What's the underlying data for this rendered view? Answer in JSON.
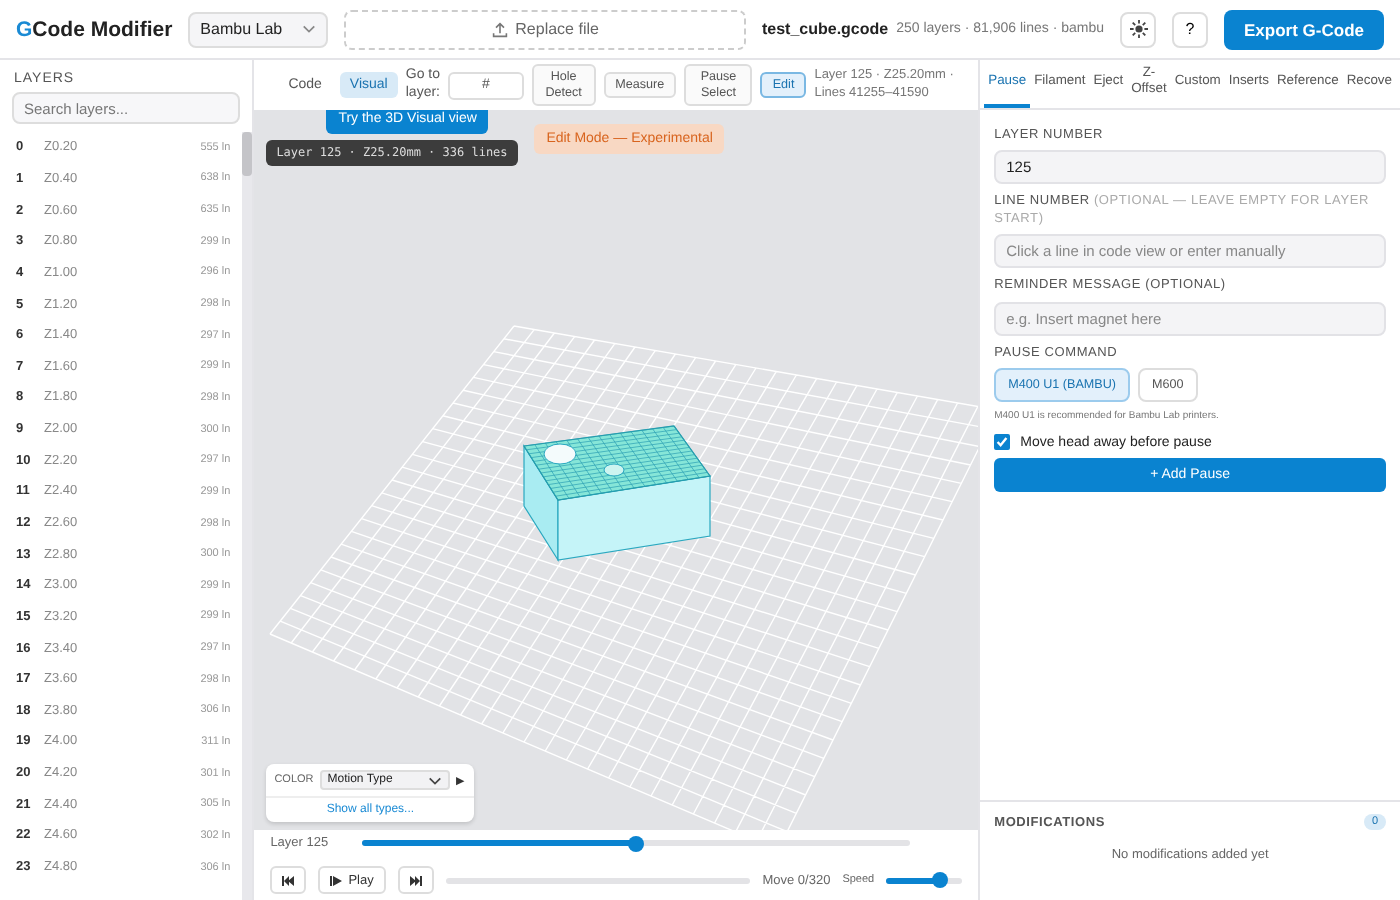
{
  "header": {
    "logo": "GCode Modifier",
    "printer_select": {
      "value": "Bambu Lab"
    },
    "replace_file": "Replace file",
    "file_name": "test_cube.gcode",
    "file_meta": "250 layers · 81,906 lines · bambu",
    "help": "?",
    "export": "Export G-Code"
  },
  "layers": {
    "title": "LAYERS",
    "search_placeholder": "Search layers...",
    "rows": [
      {
        "index": "0",
        "z": "Z0.20",
        "lines": "555 ln"
      },
      {
        "index": "1",
        "z": "Z0.40",
        "lines": "638 ln"
      },
      {
        "index": "2",
        "z": "Z0.60",
        "lines": "635 ln"
      },
      {
        "index": "3",
        "z": "Z0.80",
        "lines": "299 ln"
      },
      {
        "index": "4",
        "z": "Z1.00",
        "lines": "296 ln"
      },
      {
        "index": "5",
        "z": "Z1.20",
        "lines": "298 ln"
      },
      {
        "index": "6",
        "z": "Z1.40",
        "lines": "297 ln"
      },
      {
        "index": "7",
        "z": "Z1.60",
        "lines": "299 ln"
      },
      {
        "index": "8",
        "z": "Z1.80",
        "lines": "298 ln"
      },
      {
        "index": "9",
        "z": "Z2.00",
        "lines": "300 ln"
      },
      {
        "index": "10",
        "z": "Z2.20",
        "lines": "297 ln"
      },
      {
        "index": "11",
        "z": "Z2.40",
        "lines": "299 ln"
      },
      {
        "index": "12",
        "z": "Z2.60",
        "lines": "298 ln"
      },
      {
        "index": "13",
        "z": "Z2.80",
        "lines": "300 ln"
      },
      {
        "index": "14",
        "z": "Z3.00",
        "lines": "299 ln"
      },
      {
        "index": "15",
        "z": "Z3.20",
        "lines": "299 ln"
      },
      {
        "index": "16",
        "z": "Z3.40",
        "lines": "297 ln"
      },
      {
        "index": "17",
        "z": "Z3.60",
        "lines": "298 ln"
      },
      {
        "index": "18",
        "z": "Z3.80",
        "lines": "306 ln"
      },
      {
        "index": "19",
        "z": "Z4.00",
        "lines": "311 ln"
      },
      {
        "index": "20",
        "z": "Z4.20",
        "lines": "301 ln"
      },
      {
        "index": "21",
        "z": "Z4.40",
        "lines": "305 ln"
      },
      {
        "index": "22",
        "z": "Z4.60",
        "lines": "302 ln"
      },
      {
        "index": "23",
        "z": "Z4.80",
        "lines": "306 ln"
      }
    ]
  },
  "toolbar": {
    "views": [
      {
        "label": "Code",
        "selected": false
      },
      {
        "label": "Visual",
        "selected": true
      }
    ],
    "goto_label": "Go to layer:",
    "goto_placeholder": "#",
    "tools": [
      {
        "label": "Hole Detect",
        "on": false
      },
      {
        "label": "Measure",
        "on": false
      },
      {
        "label": "Pause Select",
        "on": false
      },
      {
        "label": "Edit",
        "on": true
      }
    ],
    "info": "Layer 125 · Z25.20mm · Lines 41255–41590"
  },
  "viewport": {
    "tooltip": "Try the 3D Visual view",
    "layer_label": "Layer 125 · Z25.20mm · 336 lines",
    "edit_badge": "Edit Mode — Experimental",
    "color_panel": {
      "label": "COLOR",
      "select": "Motion Type",
      "arrow": "▶",
      "link": "Show all types..."
    }
  },
  "playback": {
    "layer_label": "Layer 125",
    "layer_slider": {
      "level": 0.5
    },
    "play": "Play",
    "move": "Move 0/320",
    "speed_label": "Speed",
    "speed": {
      "level": 0.7
    }
  },
  "right_panel": {
    "tabs": [
      {
        "label": "Pause",
        "selected": true
      },
      {
        "label": "Filament",
        "selected": false
      },
      {
        "label": "Eject",
        "selected": false
      },
      {
        "label": "Z-Offset",
        "selected": false
      },
      {
        "label": "Custom",
        "selected": false
      },
      {
        "label": "Inserts",
        "selected": false
      },
      {
        "label": "Reference",
        "selected": false
      },
      {
        "label": "Recove",
        "selected": false
      }
    ],
    "layer_number": {
      "label": "LAYER NUMBER",
      "value": "125"
    },
    "line_number": {
      "label": "LINE NUMBER",
      "hint": "(OPTIONAL — LEAVE EMPTY FOR LAYER START)",
      "placeholder": "Click a line in code view or enter manually"
    },
    "reminder": {
      "label": "REMINDER MESSAGE (OPTIONAL)",
      "placeholder": "e.g. Insert magnet here"
    },
    "pause_command": {
      "label": "PAUSE COMMAND",
      "options": [
        {
          "label": "M400 U1 (BAMBU)",
          "selected": true
        },
        {
          "label": "M600",
          "selected": false
        }
      ],
      "note": "M400 U1 is recommended for Bambu Lab printers."
    },
    "move_head": {
      "label": "Move head away before pause",
      "checked": true
    },
    "add_button": "+ Add Pause",
    "modifications": {
      "title": "MODIFICATIONS",
      "count": "0",
      "empty": "No modifications added yet"
    }
  }
}
